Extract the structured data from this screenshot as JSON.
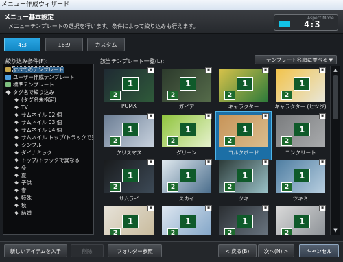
{
  "window": {
    "title": "メニュー作成ウィザード"
  },
  "header": {
    "title": "メニュー基本設定",
    "description": "メニューテンプレートの選択を行います。条件によって絞り込みも行えます。",
    "aspect_label": "Aspect Mode",
    "aspect_value": "4:3",
    "aspect_color": "#12c3e6"
  },
  "tabs": [
    {
      "label": "4:3",
      "active": true
    },
    {
      "label": "16:9",
      "active": false
    },
    {
      "label": "カスタム",
      "active": false
    }
  ],
  "filter": {
    "label": "絞り込み条件(F):",
    "items": [
      {
        "label": "すべてのテンプレート",
        "icon": "folder-icon",
        "selected": true
      },
      {
        "label": "ユーザー作成テンプレート",
        "icon": "user-folder-icon"
      },
      {
        "label": "標準テンプレート",
        "icon": "standard-folder-icon"
      },
      {
        "label": "タグ名で絞り込み",
        "icon": "tag-icon"
      },
      {
        "label": "(タグ名未指定)",
        "icon": "tag-icon"
      },
      {
        "label": "TV",
        "icon": "tag-icon"
      },
      {
        "label": "サムネイル 02 個",
        "icon": "tag-icon"
      },
      {
        "label": "サムネイル 03 個",
        "icon": "tag-icon"
      },
      {
        "label": "サムネイル 04 個",
        "icon": "tag-icon"
      },
      {
        "label": "サムネイル トップ/トラックで異なる",
        "icon": "tag-icon"
      },
      {
        "label": "シンプル",
        "icon": "tag-icon"
      },
      {
        "label": "ダイナミック",
        "icon": "tag-icon"
      },
      {
        "label": "トップ/トラックで異なる",
        "icon": "tag-icon"
      },
      {
        "label": "冬",
        "icon": "tag-icon"
      },
      {
        "label": "夏",
        "icon": "tag-icon"
      },
      {
        "label": "子供",
        "icon": "tag-icon"
      },
      {
        "label": "春",
        "icon": "tag-icon"
      },
      {
        "label": "特殊",
        "icon": "tag-icon"
      },
      {
        "label": "秋",
        "icon": "tag-icon"
      },
      {
        "label": "結婚",
        "icon": "tag-icon"
      }
    ]
  },
  "list": {
    "label": "該当テンプレート一覧(L):",
    "sort_label": "テンプレート名順に並べる",
    "templates": [
      {
        "name": "PGMX",
        "bg": "#1f2a33",
        "accent": "#2f5a3a"
      },
      {
        "name": "ガイア",
        "bg": "#2c3a2c",
        "accent": "#556b4a"
      },
      {
        "name": "キャラクター",
        "bg": "#d8c24a",
        "accent": "#2d7a3a"
      },
      {
        "name": "キャラクター (ヒツジ)",
        "bg": "#f2c34a",
        "accent": "#e8e6d8"
      },
      {
        "name": "クリスマス",
        "bg": "#6b7d94",
        "accent": "#c8d2de"
      },
      {
        "name": "グリーン",
        "bg": "#8fc43c",
        "accent": "#e7f2cf"
      },
      {
        "name": "コルクボード",
        "bg": "#c89458",
        "accent": "#d9bd8f",
        "selected": true
      },
      {
        "name": "コンクリート",
        "bg": "#7a7c7e",
        "accent": "#a9abad"
      },
      {
        "name": "サムライ",
        "bg": "#1a1c1e",
        "accent": "#3d4a57"
      },
      {
        "name": "スカイ",
        "bg": "#dfe8ee",
        "accent": "#4a6d8c"
      },
      {
        "name": "ツキ",
        "bg": "#2d3c3a",
        "accent": "#9ac2c8"
      },
      {
        "name": "ツキミ",
        "bg": "#4f7ea2",
        "accent": "#b9cfe0"
      },
      {
        "name": "",
        "bg": "#e6e2d8",
        "accent": "#c7b99a"
      },
      {
        "name": "",
        "bg": "#dde6f0",
        "accent": "#7fa3c6"
      },
      {
        "name": "",
        "bg": "#2b2f33",
        "accent": "#6c7884"
      },
      {
        "name": "",
        "bg": "#d9d9d9",
        "accent": "#8a8f94"
      }
    ]
  },
  "footer": {
    "get_new": "新しいアイテムを入手",
    "delete": "削除",
    "browse": "フォルダー参照",
    "back": "< 戻る(B)",
    "next": "次へ(N) >",
    "cancel": "キャンセル"
  }
}
